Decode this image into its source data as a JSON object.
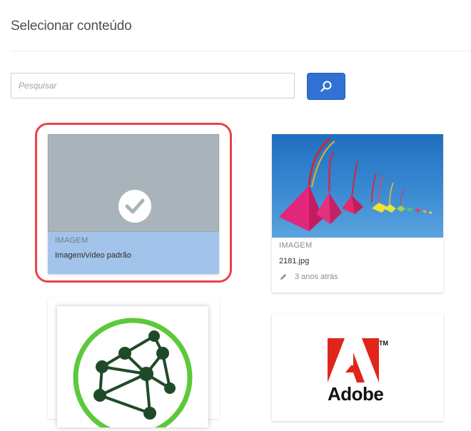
{
  "dialog": {
    "title": "Selecionar conteúdo"
  },
  "search": {
    "placeholder": "Pesquisar",
    "value": "",
    "button_icon": "search-icon"
  },
  "cards": [
    {
      "type_label": "IMAGEM",
      "name": "Imagem/vídeo padrão",
      "selected": true,
      "status_icon": "check-icon"
    },
    {
      "type_label": "IMAGEM",
      "name": "2181.jpg",
      "modified": "3 anos atrás",
      "modified_icon": "pencil-icon"
    },
    {
      "type_label": "",
      "name": ""
    },
    {
      "logo_text": "Adobe",
      "logo_tm": "TM"
    }
  ],
  "colors": {
    "accent": "#3271d4",
    "selection_ring": "#e8434b",
    "selected_meta": "#a3c4ea",
    "default_thumb": "#a9b3ba",
    "adobe_red": "#e1251b",
    "network_green": "#5cc93a"
  }
}
